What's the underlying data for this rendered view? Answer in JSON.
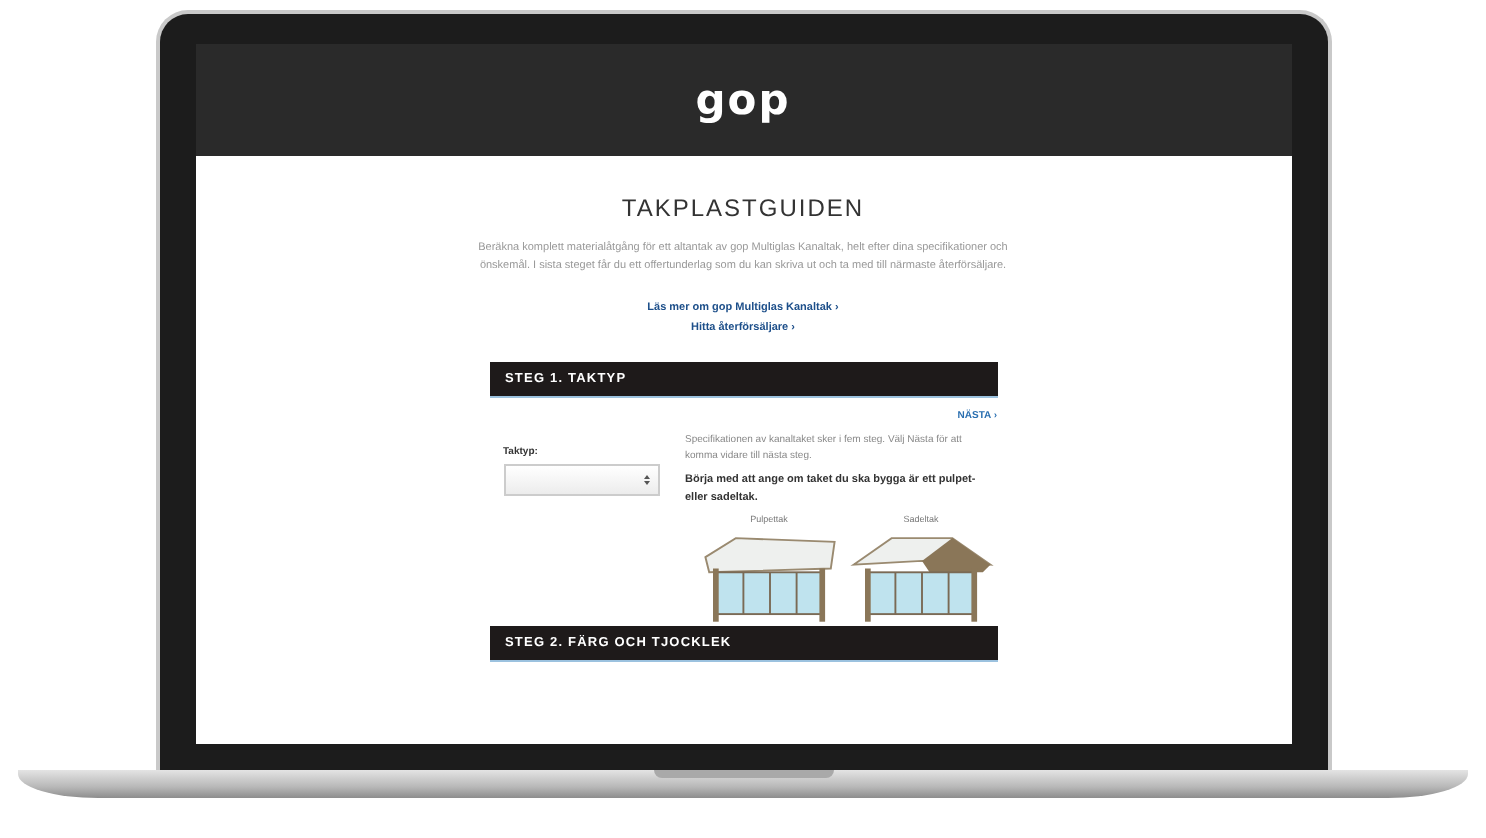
{
  "header": {
    "logo": "gop"
  },
  "title": "TAKPLASTGUIDEN",
  "intro": "Beräkna komplett materialåtgång för ett altantak av gop Multiglas Kanaltak, helt efter dina specifikationer och önskemål. I sista steget får du ett offertunderlag som du kan skriva ut och ta med till närmaste återförsäljare.",
  "links": [
    "Läs mer om gop Multiglas Kanaltak ›",
    "Hitta återförsäljare ›"
  ],
  "steps": [
    {
      "title": "STEG 1. TAKTYP",
      "next": "NÄSTA ›",
      "field_label": "Taktyp:",
      "description": "Specifikationen av kanaltaket sker i fem steg. Välj Nästa för att komma vidare till nästa steg.",
      "prompt": "Börja med att ange om taket du ska bygga är ett pulpet- eller sadeltak.",
      "roof_types": [
        {
          "kind": "lean-to",
          "label": "Pulpettak"
        },
        {
          "kind": "gable",
          "label": "Sadeltak"
        }
      ]
    },
    {
      "title": "STEG 2. FÄRG OCH TJOCKLEK"
    }
  ]
}
